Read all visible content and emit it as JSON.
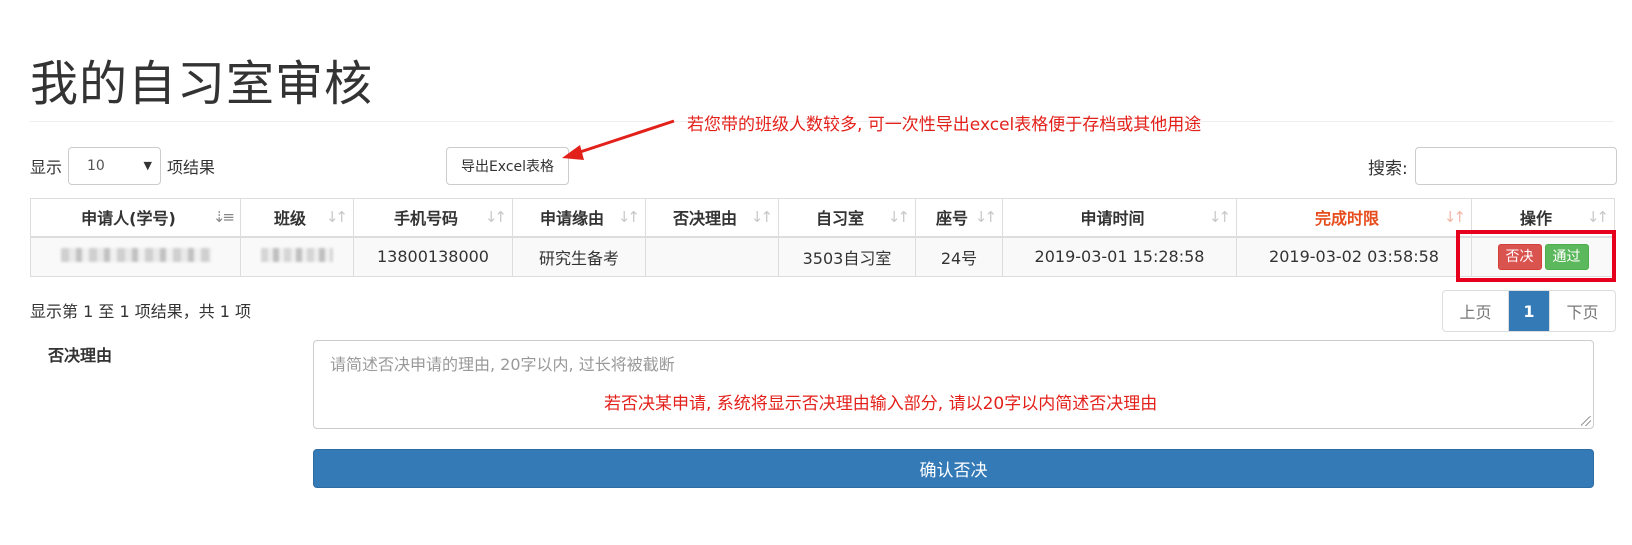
{
  "page": {
    "title": "我的自习室审核"
  },
  "length": {
    "prefix": "显示",
    "selected": "10",
    "suffix": "项结果"
  },
  "export_button": "导出Excel表格",
  "annotations": {
    "export_note": "若您带的班级人数较多, 可一次性导出excel表格便于存档或其他用途",
    "reason_note": "若否决某申请, 系统将显示否决理由输入部分, 请以20字以内简述否决理由",
    "highlight_color": "#e6001e"
  },
  "search": {
    "label": "搜索:"
  },
  "table": {
    "headers": [
      "申请人(学号)",
      "班级",
      "手机号码",
      "申请缘由",
      "否决理由",
      "自习室",
      "座号",
      "申请时间",
      "完成时限",
      "操作"
    ],
    "rows": [
      {
        "applicant": "",
        "class": "",
        "phone": "13800138000",
        "reason": "研究生备考",
        "deny_reason": "",
        "room": "3503自习室",
        "seat": "24号",
        "apply_time": "2019-03-01 15:28:58",
        "deadline": "2019-03-02 03:58:58"
      }
    ],
    "actions": {
      "deny": "否决",
      "pass": "通过"
    }
  },
  "info": "显示第 1 至 1 项结果，共 1 项",
  "pagination": {
    "prev": "上页",
    "current": "1",
    "next": "下页"
  },
  "reason_form": {
    "label": "否决理由",
    "placeholder": "请简述否决申请的理由, 20字以内, 过长将被截断",
    "confirm": "确认否决"
  },
  "colors": {
    "primary": "#337ab7",
    "danger": "#d9534f",
    "success": "#5cb85c",
    "deadline_header": "#e64c1c"
  }
}
